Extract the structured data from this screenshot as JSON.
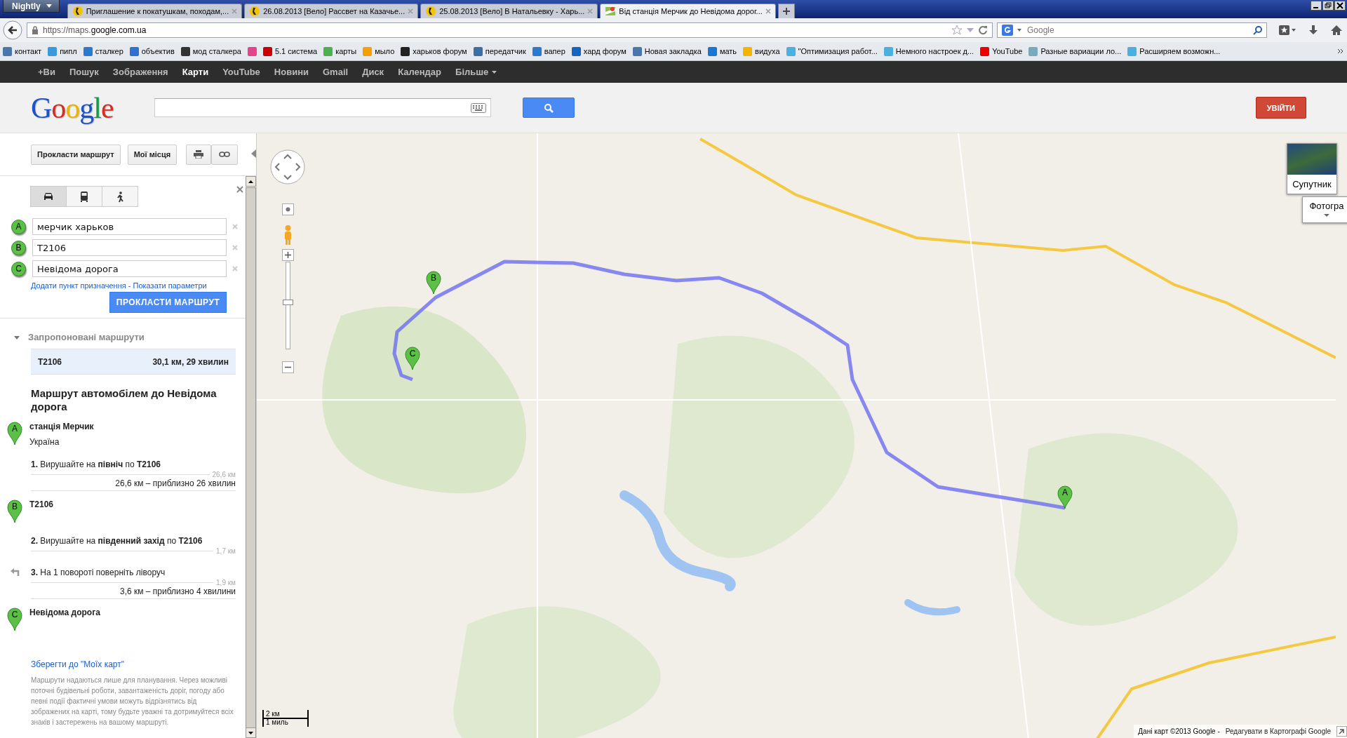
{
  "browser": {
    "menu": "Nightly",
    "tabs": [
      {
        "title": "Приглашение к покатушкам, походам,...",
        "kind": "forum",
        "selected": false
      },
      {
        "title": "26.08.2013 [Вело] Рассвет на Казачье...",
        "kind": "forum",
        "selected": false
      },
      {
        "title": "25.08.2013 [Вело] В Натальевку - Харь...",
        "kind": "forum",
        "selected": false
      },
      {
        "title": "Від станція Мерчик до Невідома дорог...",
        "kind": "maps",
        "selected": true
      }
    ],
    "url": "https://maps.**google.com.ua**",
    "search_placeholder": "Google",
    "bookmarks": [
      {
        "label": "контакт"
      },
      {
        "label": "пипл"
      },
      {
        "label": "сталкер"
      },
      {
        "label": "объектив"
      },
      {
        "label": "мод сталкера"
      },
      {
        "kind": "icon"
      },
      {
        "label": "5.1 система"
      },
      {
        "label": "карты"
      },
      {
        "label": "мыло"
      },
      {
        "label": "харьков форум"
      },
      {
        "label": "передатчик"
      },
      {
        "label": "вапер"
      },
      {
        "label": "хард форум"
      },
      {
        "label": "Новая закладка"
      },
      {
        "label": "мать"
      },
      {
        "label": "видуха"
      },
      {
        "label": "\"Оптимизация работ..."
      },
      {
        "label": "Немного настроек д..."
      },
      {
        "label": "YouTube"
      },
      {
        "label": "Разные вариации ло..."
      },
      {
        "label": "Расширяем возможн..."
      }
    ]
  },
  "google_bar": [
    {
      "label": "+Ви",
      "selected": false
    },
    {
      "label": "Пошук",
      "selected": false
    },
    {
      "label": "Зображення",
      "selected": false
    },
    {
      "label": "Карти",
      "selected": true
    },
    {
      "label": "YouTube",
      "selected": false
    },
    {
      "label": "Новини",
      "selected": false
    },
    {
      "label": "Gmail",
      "selected": false
    },
    {
      "label": "Диск",
      "selected": false
    },
    {
      "label": "Календар",
      "selected": false
    },
    {
      "label": "Більше",
      "selected": false
    }
  ],
  "header": {
    "logo": "Google",
    "sign_in": "УВІЙТИ"
  },
  "sidebar": {
    "buttons": [
      "Прокласти маршрут",
      "Мої місця"
    ],
    "modes": [
      {
        "kind": "car",
        "selected": true
      },
      {
        "kind": "bus",
        "selected": false
      },
      {
        "kind": "walk",
        "selected": false
      }
    ],
    "waypoints": [
      {
        "marker": "A",
        "value": "мерчик харьков"
      },
      {
        "marker": "B",
        "value": "T2106"
      },
      {
        "marker": "C",
        "value": "Невідома дорога"
      }
    ],
    "add_link": "Додати пункт призначення",
    "separator": "-",
    "options_link": "Показати параметри",
    "route_button": "ПРОКЛАСТИ МАРШРУТ",
    "suggested": {
      "heading": "Запропоновані маршрути",
      "expanded": true
    },
    "routes": [
      {
        "name": "T2106",
        "info": "30,1 км, 29 хвилин",
        "selected": true
      }
    ],
    "title": "Маршрут автомобілем до Невідома дорога",
    "itinerary": [
      {
        "kind": "waypoint",
        "marker": "A",
        "name": "станція Мерчик",
        "sub": "Україна"
      },
      {
        "kind": "step",
        "text": "**1.** Вирушайте на **північ** по **T2106**",
        "distance": "26,6 км"
      },
      {
        "kind": "summary",
        "text": "26,6 км – приблизно 26 хвилин"
      },
      {
        "kind": "waypoint",
        "marker": "B",
        "name": "T2106"
      },
      {
        "kind": "step",
        "text": "**2.** Вирушайте на **південний захід** по **T2106**",
        "distance": "1,7 км"
      },
      {
        "kind": "turn",
        "text": "**3.** На 1 повороті поверніть ліворуч",
        "distance": "1,9 км"
      },
      {
        "kind": "summary",
        "text": "3,6 км – приблизно 4 хвилини"
      },
      {
        "kind": "waypoint",
        "marker": "C",
        "name": "Невідома дорога"
      }
    ],
    "save_link": "Зберегти до \"Моїх карт\"",
    "disclaimer": "Маршрути надаються лише для планування. Через можливі поточні будівельні роботи, завантаженість доріг, погоду або певні події фактичні умови можуть відрізнятись від зображених на карті, тому будьте уважні та дотримуйтеся всіх знаків і застережень на вашому маршруті."
  },
  "map": {
    "zoom": {
      "level": 0.55
    },
    "markers": [
      {
        "label": "A"
      },
      {
        "label": "B"
      },
      {
        "label": "C"
      }
    ],
    "satellite": "Супутник",
    "photos": "Фотогра",
    "scale": [
      "2 км",
      "1 миль"
    ],
    "attribution": "Дані карт ©2013 Google -",
    "edit_link": "Редагувати в Картографі Google"
  }
}
